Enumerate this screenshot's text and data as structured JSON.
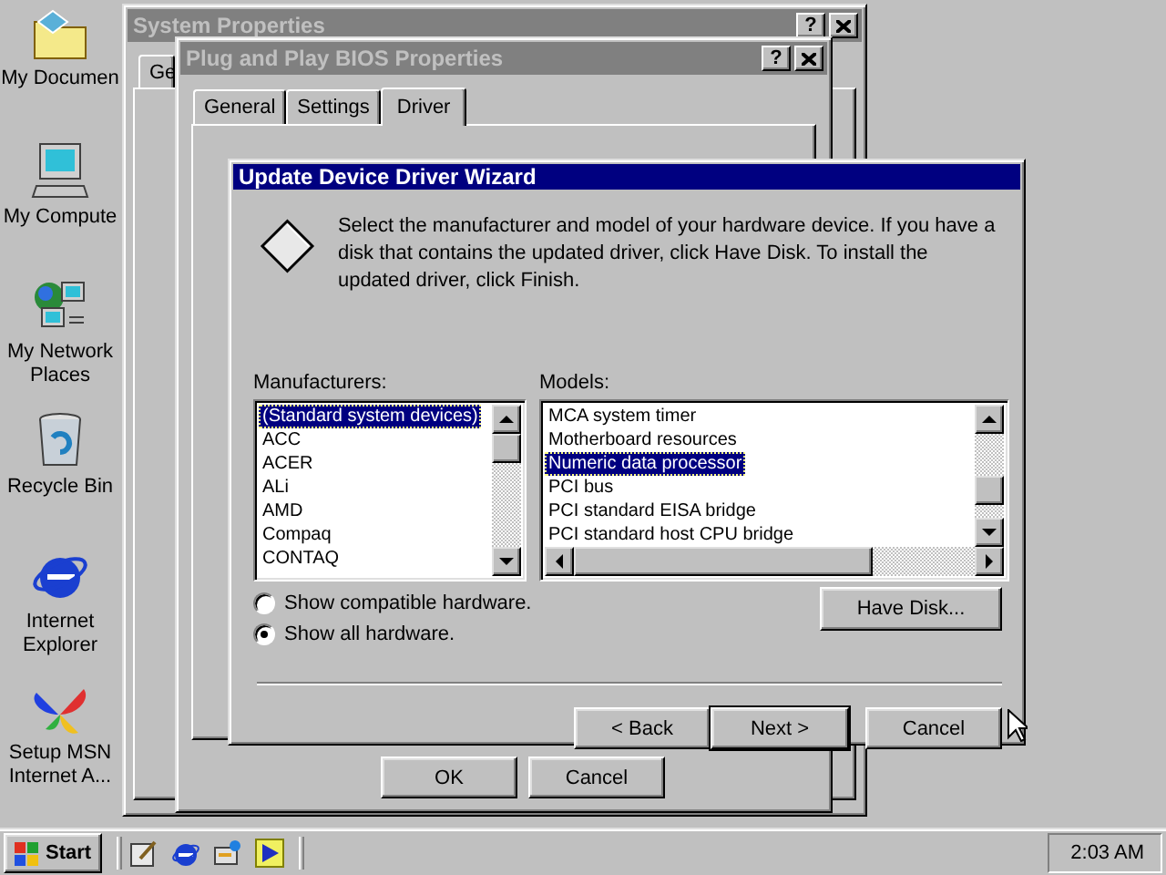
{
  "desktop_icons": [
    {
      "kind": "folder",
      "label": "My Documen"
    },
    {
      "kind": "computer",
      "label": "My Compute"
    },
    {
      "kind": "network",
      "label": "My Network Places"
    },
    {
      "kind": "recycle",
      "label": "Recycle Bin"
    },
    {
      "kind": "browser",
      "label": "Internet Explorer"
    },
    {
      "kind": "butterfly",
      "label": "Setup MSN Internet A..."
    }
  ],
  "system_properties": {
    "title": "System Properties",
    "help": "?",
    "tab_fragment": "Ge"
  },
  "bios_properties": {
    "title": "Plug and Play BIOS Properties",
    "help": "?",
    "tabs": [
      {
        "label": "General",
        "selected": false
      },
      {
        "label": "Settings",
        "selected": false
      },
      {
        "label": "Driver",
        "selected": true
      }
    ],
    "buttons": [
      "OK",
      "Cancel"
    ]
  },
  "wizard": {
    "title": "Update Device Driver Wizard",
    "instructions": "Select the manufacturer and model of your hardware device. If you have a disk that contains the updated driver, click Have Disk. To install the updated driver, click Finish.",
    "manufacturers": {
      "label": "Manufacturers:",
      "items": [
        {
          "text": "(Standard system devices)",
          "selected": true
        },
        {
          "text": "ACC",
          "selected": false
        },
        {
          "text": "ACER",
          "selected": false
        },
        {
          "text": "ALi",
          "selected": false
        },
        {
          "text": "AMD",
          "selected": false
        },
        {
          "text": "Compaq",
          "selected": false
        },
        {
          "text": "CONTAQ",
          "selected": false
        }
      ]
    },
    "models": {
      "label": "Models:",
      "items": [
        {
          "text": "MCA system timer",
          "selected": false
        },
        {
          "text": "Motherboard resources",
          "selected": false
        },
        {
          "text": "Numeric data processor",
          "selected": true
        },
        {
          "text": "PCI bus",
          "selected": false
        },
        {
          "text": "PCI standard EISA bridge",
          "selected": false
        },
        {
          "text": "PCI standard host CPU bridge",
          "selected": false
        }
      ]
    },
    "options": [
      {
        "label": "Show compatible hardware.",
        "selected": false
      },
      {
        "label": "Show all hardware.",
        "selected": true
      }
    ],
    "have_disk": "Have Disk...",
    "buttons": [
      {
        "label": "< Back",
        "default": false
      },
      {
        "label": "Next >",
        "default": true
      },
      {
        "label": "Cancel",
        "default": false
      }
    ]
  },
  "taskbar": {
    "start": "Start",
    "quick_launch": [
      {
        "kind": "desktop"
      },
      {
        "kind": "browser"
      },
      {
        "kind": "channels"
      },
      {
        "kind": "media"
      }
    ],
    "clock": "2:03 AM"
  }
}
